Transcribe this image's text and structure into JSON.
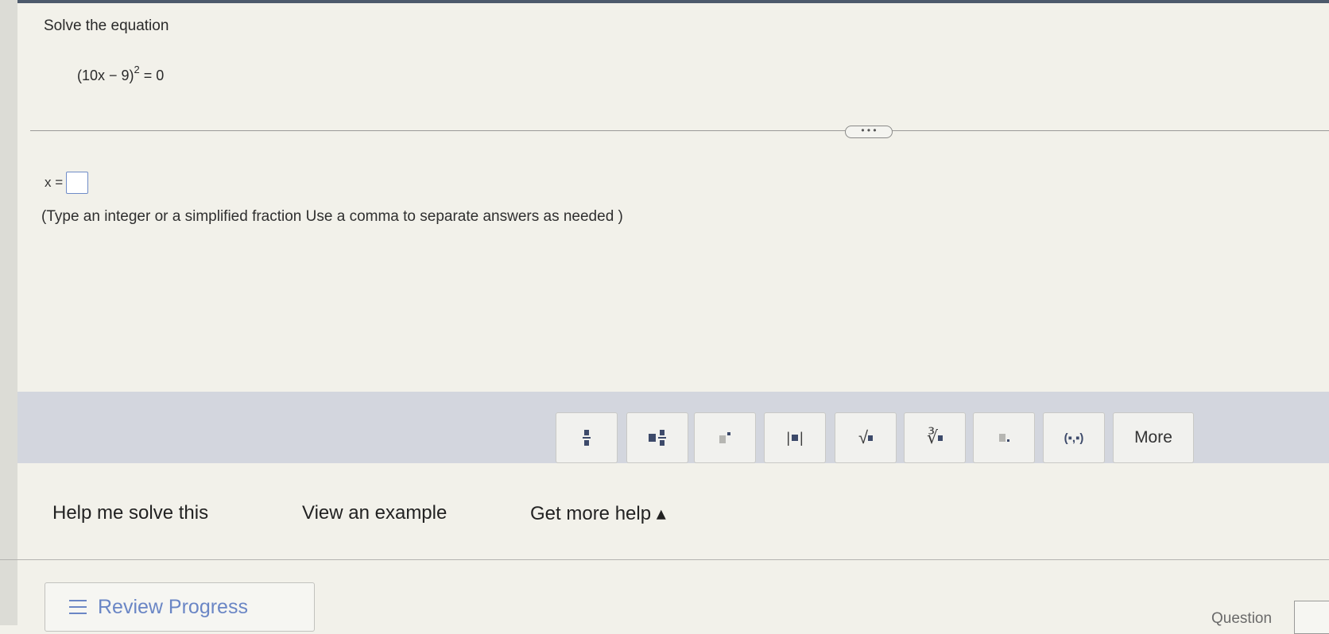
{
  "problem": {
    "instruction": "Solve the equation",
    "equation_base": "(10x − 9)",
    "equation_exponent": "2",
    "equation_rhs": " = 0"
  },
  "ellipsis": "• • •",
  "answer": {
    "label": "x =",
    "value": "",
    "hint": "(Type an integer or a simplified fraction  Use a comma to separate answers as needed )"
  },
  "toolbar": {
    "buttons": [
      {
        "name": "fraction",
        "icon": "fraction-icon"
      },
      {
        "name": "mixed-number",
        "icon": "mixed-number-icon"
      },
      {
        "name": "exponent",
        "icon": "exponent-icon"
      },
      {
        "name": "absolute-value",
        "icon": "absolute-value-icon"
      },
      {
        "name": "square-root",
        "icon": "square-root-icon",
        "label": "√"
      },
      {
        "name": "nth-root",
        "icon": "nth-root-icon",
        "label": "∛"
      },
      {
        "name": "decimal",
        "icon": "decimal-icon"
      },
      {
        "name": "ordered-pair",
        "icon": "ordered-pair-icon",
        "label": "(▪,▪)"
      }
    ],
    "more_label": "More"
  },
  "help": {
    "solve_label": "Help me solve this",
    "example_label": "View an example",
    "more_help_label": "Get more help ▴"
  },
  "footer": {
    "review_label": "Review Progress",
    "question_label": "Question"
  },
  "colors": {
    "accent": "#6a86c5",
    "toolbar_bg": "#d3d6de",
    "page_bg": "#f2f1ea"
  }
}
